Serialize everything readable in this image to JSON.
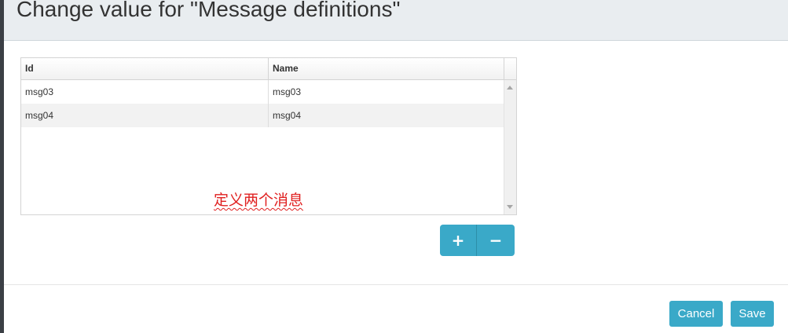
{
  "dialog": {
    "title": "Change value for \"Message definitions\""
  },
  "table": {
    "columns": [
      "Id",
      "Name"
    ],
    "rows": [
      {
        "id": "msg03",
        "name": "msg03"
      },
      {
        "id": "msg04",
        "name": "msg04"
      }
    ]
  },
  "annotation": {
    "text": "定义两个消息",
    "color": "#e02020"
  },
  "controls": {
    "add_icon": "plus-icon",
    "add_glyph": "+",
    "remove_icon": "minus-icon",
    "remove_glyph": "−"
  },
  "footer": {
    "cancel_label": "Cancel",
    "save_label": "Save"
  },
  "colors": {
    "accent": "#3aa9c8",
    "header_bg": "#e9edf0"
  }
}
